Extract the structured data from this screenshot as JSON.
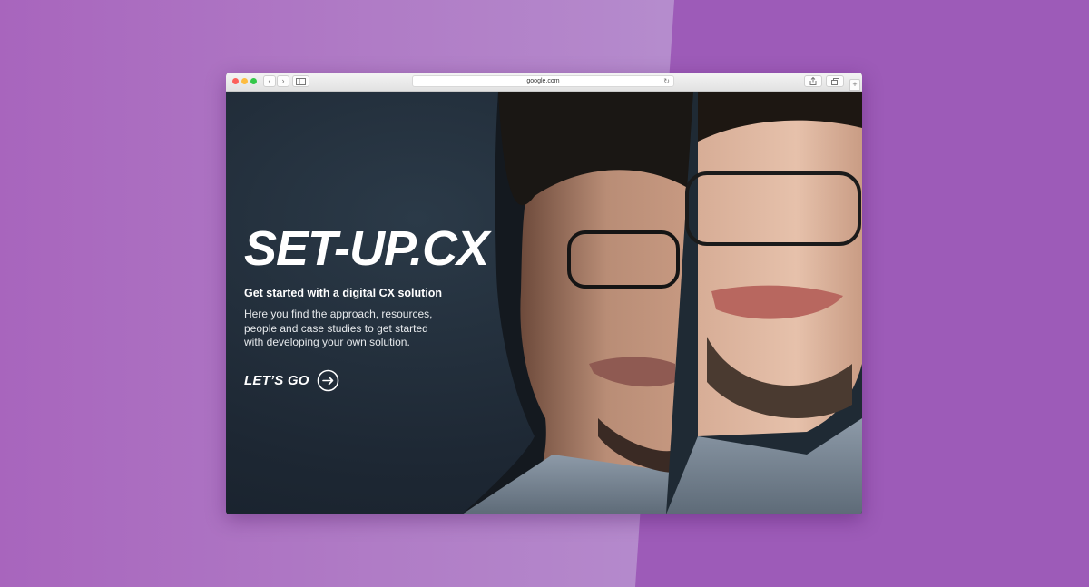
{
  "browser": {
    "url": "google.com"
  },
  "hero": {
    "title": "SET-UP.CX",
    "subtitle": "Get started with a digital CX solution",
    "description": "Here you find the approach, resources, people and case studies to get started with developing your own solution.",
    "cta_label": "LET’S GO",
    "cta_icon": "arrow-right-circle-icon"
  },
  "colors": {
    "page_background": "#9d5bb8",
    "hero_background": "#1f2c38",
    "text": "#ffffff"
  }
}
